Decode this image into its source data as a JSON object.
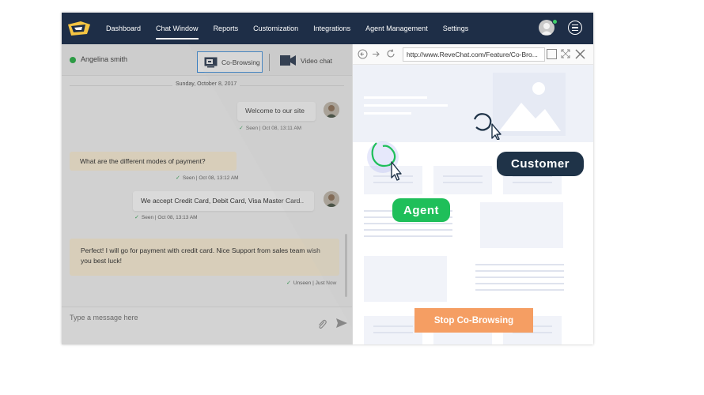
{
  "nav": {
    "items": [
      {
        "label": "Dashboard",
        "name": "nav-dashboard"
      },
      {
        "label": "Chat Window",
        "name": "nav-chat-window"
      },
      {
        "label": "Reports",
        "name": "nav-reports"
      },
      {
        "label": "Customization",
        "name": "nav-customization"
      },
      {
        "label": "Integrations",
        "name": "nav-integrations"
      },
      {
        "label": "Agent Management",
        "name": "nav-agent-management"
      },
      {
        "label": "Settings",
        "name": "nav-settings"
      }
    ],
    "active": "Chat Window",
    "logo_icon": "revechat-logo-icon",
    "menu_icon": "hamburger-menu-icon"
  },
  "chat": {
    "visitor_name": "Angelina smith",
    "cobrowse_label": "Co-Browsing",
    "video_label": "Video chat",
    "date": "Sunday, October 8, 2017",
    "messages": [
      {
        "text": "Welcome to our site",
        "meta": "Seen | Oct 08, 13:11 AM"
      },
      {
        "text": "What are the different modes of payment?",
        "meta": "Seen | Oct 08, 13:12 AM"
      },
      {
        "text": "We accept Credit Card, Debit Card, Visa Master Card..",
        "meta": "Seen | Oct 08, 13:13 AM"
      },
      {
        "text": "Perfect! I will go for payment with credit card. Nice Support from sales team wish you best luck!",
        "meta": "Unseen | Just Now"
      }
    ],
    "input_placeholder": "Type a message here"
  },
  "browser": {
    "url": "http://www.ReveChat.com/Feature/Co-Bro...",
    "customer_label": "Customer",
    "agent_label": "Agent",
    "stop_label": "Stop Co-Browsing"
  },
  "colors": {
    "nav_bg": "#1e2e47",
    "agent_green": "#1fbf5a",
    "customer_dark": "#1f3348",
    "stop_orange": "#f59e63",
    "online": "#2db34a"
  }
}
